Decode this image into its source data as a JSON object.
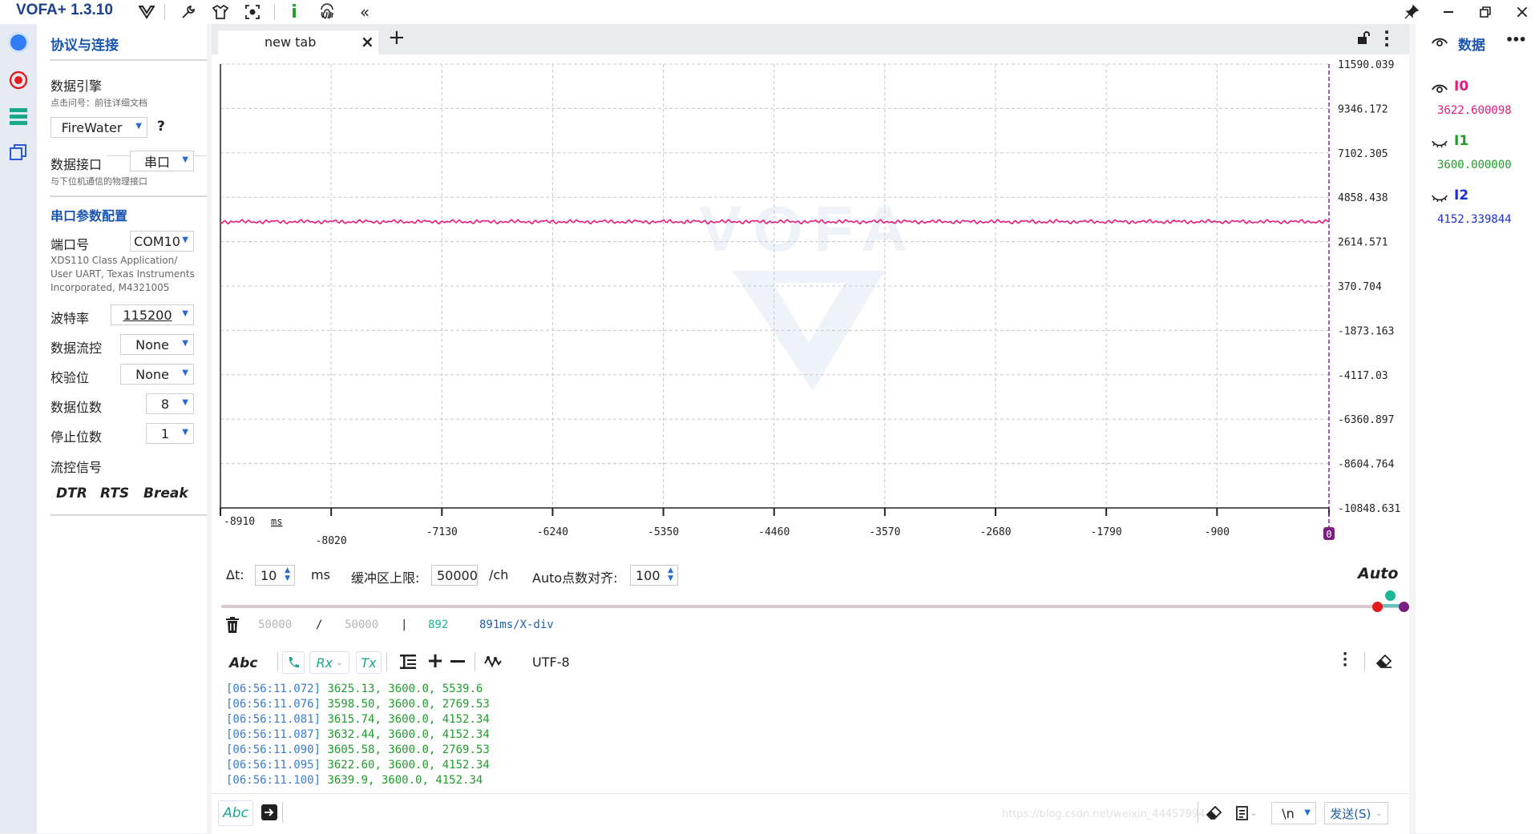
{
  "app": {
    "title": "VOFA+ 1.3.10"
  },
  "left_panel": {
    "section_title": "协议与连接",
    "engine_label": "数据引擎",
    "engine_hint": "点击问号：前往详细文档",
    "engine_value": "FireWater",
    "help_label": "?",
    "interface_label": "数据接口",
    "interface_value": "串口",
    "interface_hint": "与下位机通信的物理接口",
    "serial_title": "串口参数配置",
    "port_label": "端口号",
    "port_value": "COM10",
    "port_desc_1": "XDS110 Class Application/",
    "port_desc_2": "User UART, Texas Instruments",
    "port_desc_3": "Incorporated, M4321005",
    "baud_label": "波特率",
    "baud_value": "115200",
    "flowctl_label": "数据流控",
    "flowctl_value": "None",
    "parity_label": "校验位",
    "parity_value": "None",
    "databits_label": "数据位数",
    "databits_value": "8",
    "stopbits_label": "停止位数",
    "stopbits_value": "1",
    "signal_label": "流控信号",
    "dtr": "DTR",
    "rts": "RTS",
    "brk": "Break"
  },
  "tab": {
    "label": "new tab",
    "close": "×",
    "add": "+"
  },
  "chart_data": {
    "type": "line",
    "x_unit": "ms",
    "x_ticks": [
      -8910,
      -8020,
      -7130,
      -6240,
      -5350,
      -4460,
      -3570,
      -2680,
      -1790,
      -900,
      0
    ],
    "y_ticks": [
      "11590.039",
      "9346.172",
      "7102.305",
      "4858.438",
      "2614.571",
      "370.704",
      "-1873.163",
      "-4117.03",
      "-6360.897",
      "-8604.764",
      "-10848.631"
    ],
    "ylim": [
      -10848.631,
      11590.039
    ],
    "xlim": [
      -8910,
      0
    ],
    "grid": true,
    "series": [
      {
        "name": "I0",
        "color": "#e8197d",
        "approx_level": 3622
      }
    ],
    "watermark": "VOFA"
  },
  "controls": {
    "dt_label": "Δt:",
    "dt_value": "10",
    "dt_unit": "ms",
    "buffer_label": "缓冲区上限:",
    "buffer_value": "50000",
    "buffer_unit": "/ch",
    "auto_align_label": "Auto点数对齐:",
    "auto_align_value": "100",
    "auto_label": "Auto",
    "count_a": "50000",
    "slash": "/",
    "count_b": "50000",
    "bar": "|",
    "count_c": "892",
    "xdiv": "891ms/X-div"
  },
  "console": {
    "abc": "Abc",
    "rx": "Rx",
    "tx": "Tx",
    "encoding": "UTF-8",
    "lines": [
      {
        "ts": "[06:56:11.072]",
        "data": "3625.13, 3600.0, 5539.6"
      },
      {
        "ts": "[06:56:11.076]",
        "data": "3598.50, 3600.0, 2769.53"
      },
      {
        "ts": "[06:56:11.081]",
        "data": "3615.74, 3600.0, 4152.34"
      },
      {
        "ts": "[06:56:11.087]",
        "data": "3632.44, 3600.0, 4152.34"
      },
      {
        "ts": "[06:56:11.090]",
        "data": "3605.58, 3600.0, 2769.53"
      },
      {
        "ts": "[06:56:11.095]",
        "data": "3622.60, 3600.0, 4152.34"
      },
      {
        "ts": "[06:56:11.100]",
        "data": "3639.9, 3600.0, 4152.34"
      }
    ]
  },
  "sendbar": {
    "abc": "Abc",
    "newline": "\\n",
    "send_label": "发送(S)",
    "watermark_text": "https://blog.csdn.net/weixin_44457994"
  },
  "right_panel": {
    "title": "数据",
    "more": "•••",
    "channels": [
      {
        "name": "I0",
        "value": "3622.600098",
        "color": "#e8197d"
      },
      {
        "name": "I1",
        "value": "3600.000000",
        "color": "#1f9d2b"
      },
      {
        "name": "I2",
        "value": "4152.339844",
        "color": "#1c2fd6"
      }
    ]
  }
}
